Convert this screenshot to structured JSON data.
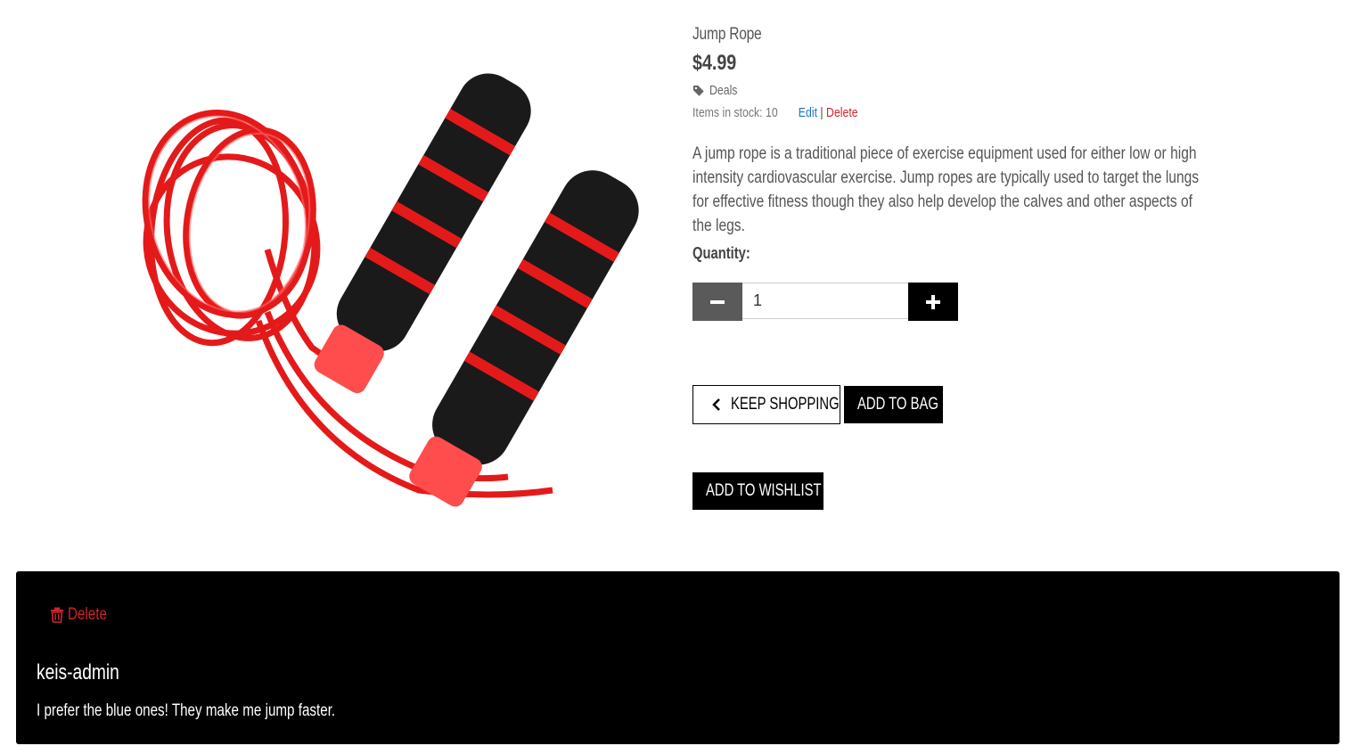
{
  "product": {
    "name": "Jump Rope",
    "price": "$4.99",
    "category": "Deals",
    "stock_text": "Items in stock: 10",
    "edit_label": "Edit",
    "separator": "|",
    "delete_label": "Delete",
    "description": "A jump rope is a traditional piece of exercise equipment used for either low or high intensity cardiovascular exercise. Jump ropes are typically used to target the lungs for effective fitness though they also help develop the calves and other aspects of the legs.",
    "image_alt": "Jump rope with red cord and black foam handles",
    "image_icon": "jump-rope-photo"
  },
  "quantity": {
    "label": "Quantity:",
    "value": "1",
    "decrement_icon": "minus-icon",
    "increment_icon": "plus-icon"
  },
  "actions": {
    "keep_shopping": "KEEP SHOPPING",
    "add_to_bag": "ADD TO BAG",
    "add_to_wishlist": "ADD TO WISHLIST"
  },
  "review": {
    "delete_label": "Delete",
    "author": "keis-admin",
    "text": "I prefer the blue ones! They make me jump faster."
  },
  "colors": {
    "accent_red": "#d0232b",
    "link_blue": "#1a73c8",
    "dark": "#000000",
    "minus_bg": "#5a5a5a"
  }
}
